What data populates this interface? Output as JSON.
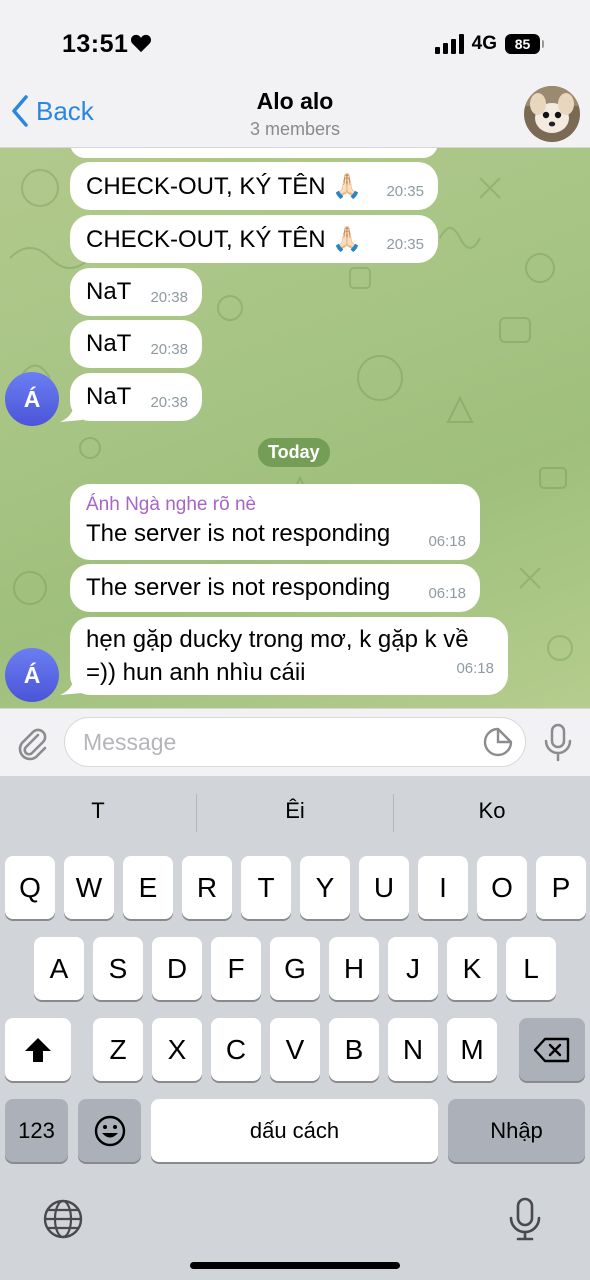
{
  "status": {
    "time": "13:51",
    "network": "4G",
    "battery": "85"
  },
  "header": {
    "back_label": "Back",
    "title": "Alo alo",
    "subtitle": "3 members"
  },
  "messages": [
    {
      "text": "CHECK-OUT, KÝ TÊN 🙏🏻",
      "time": "20:35"
    },
    {
      "text": "CHECK-OUT, KÝ TÊN 🙏🏻",
      "time": "20:35"
    },
    {
      "text": "NaT",
      "time": "20:38"
    },
    {
      "text": "NaT",
      "time": "20:38"
    },
    {
      "text": "NaT",
      "time": "20:38",
      "avatar": "Á"
    },
    {
      "sender": "Ánh Ngà nghe rõ nè",
      "text": "The server is not responding",
      "time": "06:18"
    },
    {
      "text": "The server is not responding",
      "time": "06:18"
    },
    {
      "text_line1": "hẹn gặp ducky trong mơ, k gặp k về",
      "text_line2": "=)) hun anh nhìu cáii",
      "time": "06:18",
      "avatar": "Á"
    }
  ],
  "date_separator": "Today",
  "input": {
    "placeholder": "Message",
    "value": ""
  },
  "keyboard": {
    "suggestions": [
      "T",
      "Êi",
      "Ko"
    ],
    "row1": [
      "Q",
      "W",
      "E",
      "R",
      "T",
      "Y",
      "U",
      "I",
      "O",
      "P"
    ],
    "row2": [
      "A",
      "S",
      "D",
      "F",
      "G",
      "H",
      "J",
      "K",
      "L"
    ],
    "row3": [
      "Z",
      "X",
      "C",
      "V",
      "B",
      "N",
      "M"
    ],
    "numbers_label": "123",
    "space_label": "dấu cách",
    "return_label": "Nhập"
  },
  "icons": {
    "back": "chevron-left-icon",
    "attach": "paperclip-icon",
    "sticker": "sticker-icon",
    "mic": "microphone-icon",
    "globe": "globe-icon",
    "shift": "shift-icon",
    "delete": "backspace-icon",
    "emoji": "emoji-icon"
  },
  "colors": {
    "accent": "#2a87e0",
    "sender_name": "#a865c8",
    "avatar": "#5a66e6",
    "date_pill": "#6c964e"
  }
}
